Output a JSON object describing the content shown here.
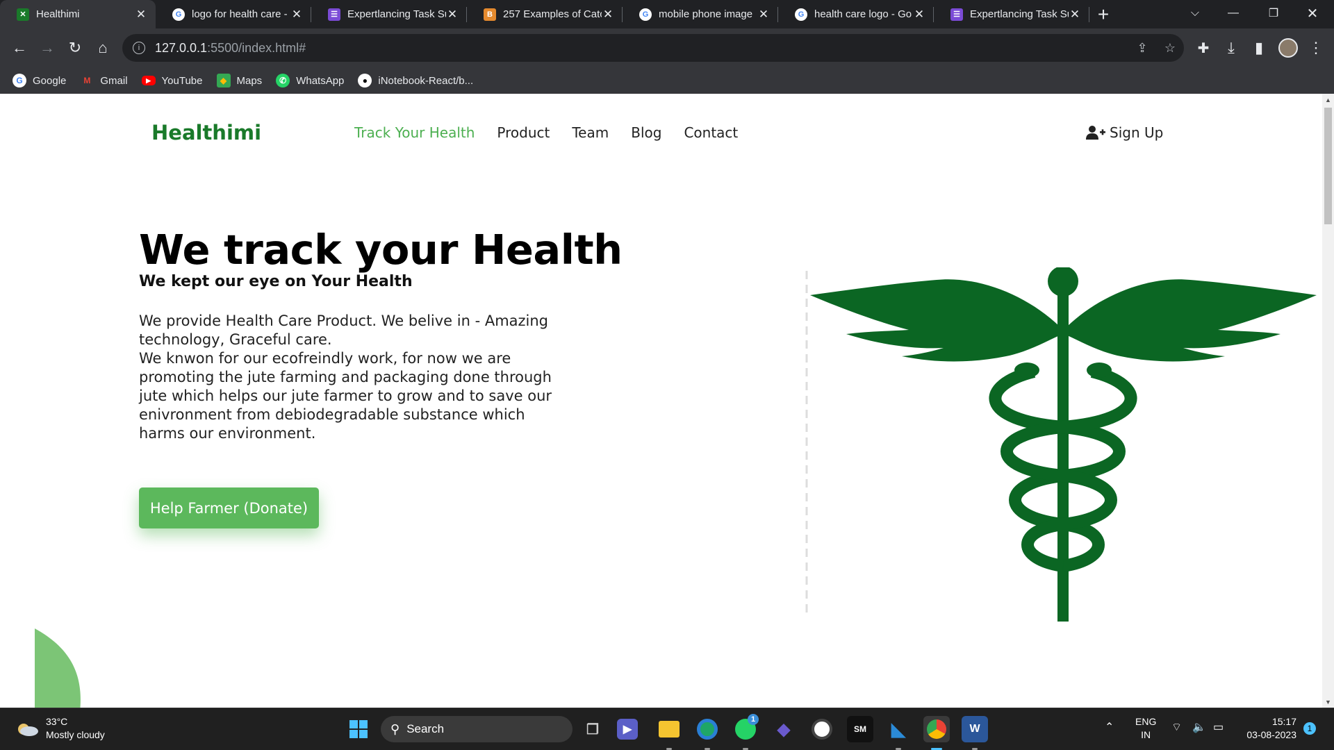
{
  "browser": {
    "tabs": [
      {
        "title": "Healthimi",
        "active": true,
        "favicon": "healthimi-favicon",
        "color": "#e8eaed"
      },
      {
        "title": "logo for health care -",
        "active": false,
        "favicon": "google-favicon",
        "color": "#ffffff"
      },
      {
        "title": "Expertlancing Task Sul",
        "active": false,
        "favicon": "forms-favicon",
        "color": "#7b4bd6"
      },
      {
        "title": "257 Examples of Catc",
        "active": false,
        "favicon": "blogger-favicon",
        "color": "#e58a2e"
      },
      {
        "title": "mobile phone image",
        "active": false,
        "favicon": "google-favicon",
        "color": "#ffffff"
      },
      {
        "title": "health care logo - Go",
        "active": false,
        "favicon": "google-favicon",
        "color": "#ffffff"
      },
      {
        "title": "Expertlancing Task Sul",
        "active": false,
        "favicon": "forms-favicon",
        "color": "#7b4bd6"
      }
    ],
    "url_host": "127.0.0.1",
    "url_rest": ":5500/index.html#",
    "bookmarks": [
      {
        "label": "Google",
        "icon": "google-icon",
        "color": "#ffffff"
      },
      {
        "label": "Gmail",
        "icon": "gmail-icon",
        "color": "#ea4335"
      },
      {
        "label": "YouTube",
        "icon": "youtube-icon",
        "color": "#ff0000"
      },
      {
        "label": "Maps",
        "icon": "maps-icon",
        "color": "#34a853"
      },
      {
        "label": "WhatsApp",
        "icon": "whatsapp-icon",
        "color": "#25d366"
      },
      {
        "label": "iNotebook-React/b...",
        "icon": "github-icon",
        "color": "#ffffff"
      }
    ]
  },
  "site": {
    "brand": "Healthimi",
    "nav": [
      "Track Your Health",
      "Product",
      "Team",
      "Blog",
      "Contact"
    ],
    "signup": "Sign Up",
    "hero_title": "We track your Health",
    "hero_subtitle": "We kept our eye on Your Health",
    "hero_desc_1": "We provide Health Care Product. We belive in - Amazing technology, Graceful care.",
    "hero_desc_2": "We knwon for our ecofreindly work, for now we are promoting the jute farming and packaging done through jute which helps our jute farmer to grow and to save our enivronment from debiodegradable substance which harms our environment.",
    "donate_label": "Help Farmer (Donate)",
    "colors": {
      "brand": "#1a7a2a",
      "accent": "#4caf50",
      "button": "#5cb85c",
      "logo": "#0b6623"
    }
  },
  "taskbar": {
    "temperature": "33°C",
    "weather": "Mostly cloudy",
    "search_label": "Search",
    "language": "ENG",
    "region": "IN",
    "time": "15:17",
    "date": "03-08-2023",
    "notification_count": "1",
    "whatsapp_badge": "1"
  }
}
